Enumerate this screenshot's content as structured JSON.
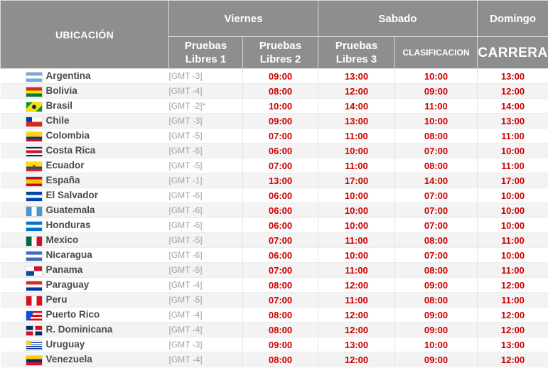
{
  "header": {
    "location_label": "UBICACIÓN",
    "days": {
      "friday": "Viernes",
      "saturday": "Sabado",
      "sunday": "Domingo"
    },
    "sessions": {
      "p1_line1": "Pruebas",
      "p1_line2": "Libres 1",
      "p2_line1": "Pruebas",
      "p2_line2": "Libres 2",
      "p3_line1": "Pruebas",
      "p3_line2": "Libres 3",
      "qualifying": "CLASIFICACION",
      "race": "CARRERA"
    }
  },
  "colors": {
    "header_bg": "#8e8e8e",
    "time_red": "#cc0000",
    "country_text": "#4a4a4a",
    "gmt_text": "#a3a3a3"
  },
  "rows": [
    {
      "country": "Argentina",
      "gmt": "[GMT -3]",
      "p1": "09:00",
      "p2": "13:00",
      "p3": "10:00",
      "q": "13:00",
      "race": "13:00",
      "flag": "flag-argentina"
    },
    {
      "country": "Bolivia",
      "gmt": "[GMT -4]",
      "p1": "08:00",
      "p2": "12:00",
      "p3": "09:00",
      "q": "12:00",
      "race": "12:00",
      "flag": "flag-bolivia"
    },
    {
      "country": "Brasil",
      "gmt": "[GMT -2]*",
      "p1": "10:00",
      "p2": "14:00",
      "p3": "11:00",
      "q": "14:00",
      "race": "14:00",
      "flag": "flag-brasil"
    },
    {
      "country": "Chile",
      "gmt": "[GMT -3]",
      "p1": "09:00",
      "p2": "13:00",
      "p3": "10:00",
      "q": "13:00",
      "race": "13:00",
      "flag": "flag-chile"
    },
    {
      "country": "Colombia",
      "gmt": "[GMT -5]",
      "p1": "07:00",
      "p2": "11:00",
      "p3": "08:00",
      "q": "11:00",
      "race": "11:00",
      "flag": "flag-colombia"
    },
    {
      "country": "Costa Rica",
      "gmt": "[GMT -6]",
      "p1": "06:00",
      "p2": "10:00",
      "p3": "07:00",
      "q": "10:00",
      "race": "10:00",
      "flag": "flag-costa-rica"
    },
    {
      "country": "Ecuador",
      "gmt": "[GMT -5]",
      "p1": "07:00",
      "p2": "11:00",
      "p3": "08:00",
      "q": "11:00",
      "race": "11:00",
      "flag": "flag-ecuador"
    },
    {
      "country": "España",
      "gmt": "[GMT -1]",
      "p1": "13:00",
      "p2": "17:00",
      "p3": "14:00",
      "q": "17:00",
      "race": "17:00",
      "flag": "flag-espana"
    },
    {
      "country": "El Salvador",
      "gmt": "[GMT -6]",
      "p1": "06:00",
      "p2": "10:00",
      "p3": "07:00",
      "q": "10:00",
      "race": "10:00",
      "flag": "flag-el-salvador"
    },
    {
      "country": "Guatemala",
      "gmt": "[GMT -6]",
      "p1": "06:00",
      "p2": "10:00",
      "p3": "07:00",
      "q": "10:00",
      "race": "10:00",
      "flag": "flag-guatemala"
    },
    {
      "country": "Honduras",
      "gmt": "[GMT -6]",
      "p1": "06:00",
      "p2": "10:00",
      "p3": "07:00",
      "q": "10:00",
      "race": "10:00",
      "flag": "flag-honduras"
    },
    {
      "country": "Mexico",
      "gmt": "[GMT -5]",
      "p1": "07:00",
      "p2": "11:00",
      "p3": "08:00",
      "q": "11:00",
      "race": "11:00",
      "flag": "flag-mexico"
    },
    {
      "country": "Nicaragua",
      "gmt": "[GMT -6]",
      "p1": "06:00",
      "p2": "10:00",
      "p3": "07:00",
      "q": "10:00",
      "race": "10:00",
      "flag": "flag-nicaragua"
    },
    {
      "country": "Panama",
      "gmt": "[GMT -5]",
      "p1": "07:00",
      "p2": "11:00",
      "p3": "08:00",
      "q": "11:00",
      "race": "11:00",
      "flag": "flag-panama"
    },
    {
      "country": "Paraguay",
      "gmt": "[GMT -4]",
      "p1": "08:00",
      "p2": "12:00",
      "p3": "09:00",
      "q": "12:00",
      "race": "12:00",
      "flag": "flag-paraguay"
    },
    {
      "country": "Peru",
      "gmt": "[GMT -5]",
      "p1": "07:00",
      "p2": "11:00",
      "p3": "08:00",
      "q": "11:00",
      "race": "11:00",
      "flag": "flag-peru"
    },
    {
      "country": "Puerto Rico",
      "gmt": "[GMT -4]",
      "p1": "08:00",
      "p2": "12:00",
      "p3": "09:00",
      "q": "12:00",
      "race": "12:00",
      "flag": "flag-puerto-rico"
    },
    {
      "country": "R. Dominicana",
      "gmt": "[GMT -4]",
      "p1": "08:00",
      "p2": "12:00",
      "p3": "09:00",
      "q": "12:00",
      "race": "12:00",
      "flag": "flag-r-dominicana"
    },
    {
      "country": "Uruguay",
      "gmt": "[GMT -3]",
      "p1": "09:00",
      "p2": "13:00",
      "p3": "10:00",
      "q": "13:00",
      "race": "13:00",
      "flag": "flag-uruguay"
    },
    {
      "country": "Venezuela",
      "gmt": "[GMT -4]",
      "p1": "08:00",
      "p2": "12:00",
      "p3": "09:00",
      "q": "12:00",
      "race": "12:00",
      "flag": "flag-venezuela"
    }
  ]
}
